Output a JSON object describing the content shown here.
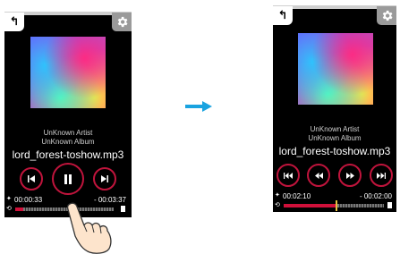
{
  "left": {
    "artist": "UnKnown Artist",
    "album": "UnKnown Album",
    "title": "lord_forest-toshow.mp3",
    "elapsed": "00:00:33",
    "remaining": "- 00:03:37",
    "progress": 0.08,
    "back_glyph": "↰"
  },
  "right": {
    "artist": "UnKnown Artist",
    "album": "UnKnown Album",
    "title": "lord_forest-toshow.mp3",
    "elapsed": "00:02:10",
    "remaining": "- 00:02:00",
    "progress": 0.52,
    "back_glyph": "↰"
  },
  "icons": {
    "settings": "gear-icon",
    "back": "back-arrow-icon",
    "transition": "right-arrow",
    "gesture": "pointing-hand"
  },
  "colors": {
    "accent": "#c0143c",
    "arrow": "#1aa3e0"
  }
}
